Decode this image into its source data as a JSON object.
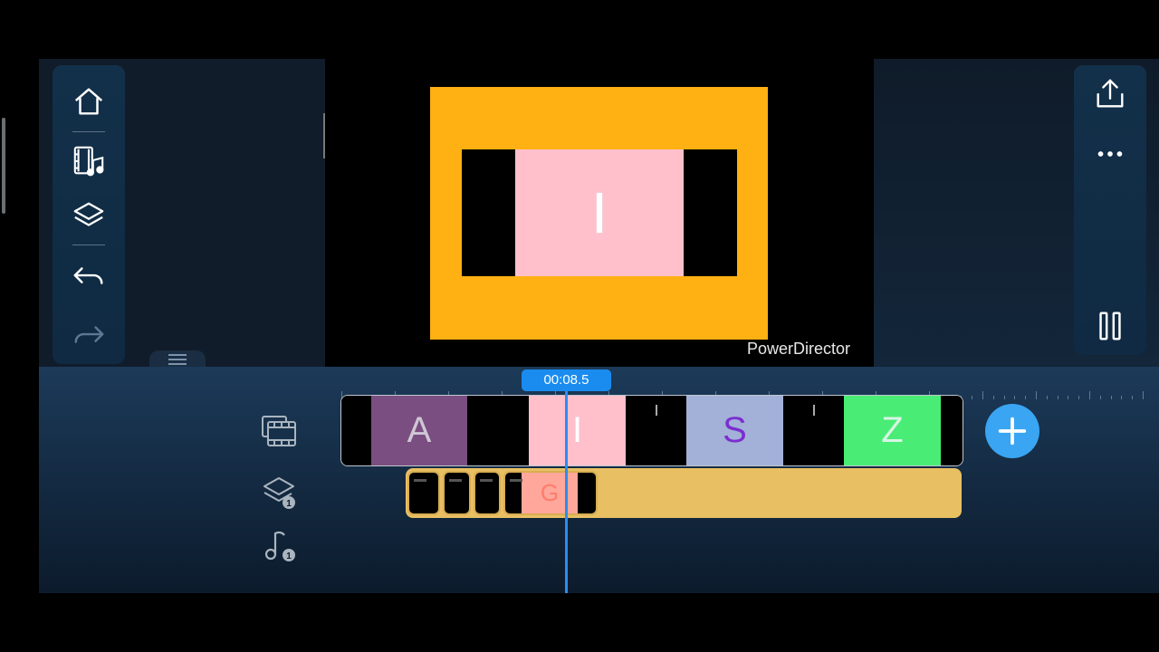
{
  "app": {
    "watermark": "PowerDirector"
  },
  "colors": {
    "accent": "#1a8cf0",
    "frame_border": "#ffb012",
    "frame_center": "#ffc0cb",
    "overlay_track": "#e8bf62"
  },
  "left_toolbar": {
    "buttons": [
      {
        "icon": "home-icon"
      },
      {
        "icon": "media-music-icon"
      },
      {
        "icon": "layers-icon"
      },
      {
        "icon": "undo-icon"
      },
      {
        "icon": "redo-icon"
      }
    ]
  },
  "right_toolbar": {
    "buttons": [
      {
        "icon": "share-icon"
      },
      {
        "icon": "more-icon"
      },
      {
        "icon": "pause-icon"
      }
    ]
  },
  "preview": {
    "letter": "I"
  },
  "timeline": {
    "current_time": "00:08.5",
    "track_icons": [
      {
        "icon": "video-track-icon"
      },
      {
        "icon": "overlay-layer-icon",
        "badge": "1"
      },
      {
        "icon": "audio-track-icon",
        "badge": "1"
      }
    ],
    "video_clips": [
      {
        "letter": "A",
        "color": "#7a4e80"
      },
      {
        "letter": "I",
        "color": "#ffc0cb"
      },
      {
        "letter": "S",
        "color": "#a3b1d8"
      },
      {
        "letter": "Z",
        "color": "#49ed75"
      }
    ],
    "overlay_clips": [
      {
        "letter": ""
      },
      {
        "letter": ""
      },
      {
        "letter": ""
      },
      {
        "letter": "G"
      }
    ]
  }
}
